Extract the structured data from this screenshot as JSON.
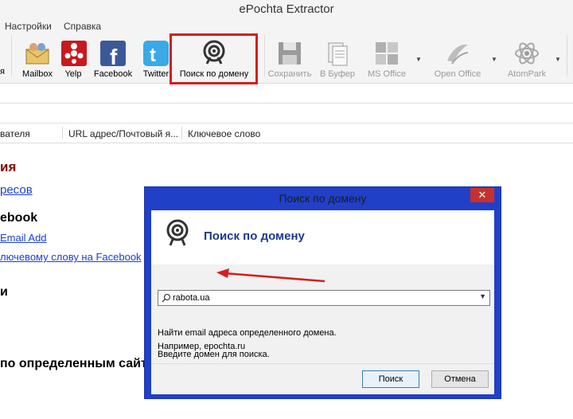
{
  "window": {
    "title": "ePochta Extractor"
  },
  "menu": {
    "items": [
      "Настройки",
      "Справка"
    ]
  },
  "toolbar": {
    "partial_left_label": "я",
    "buttons": [
      {
        "label": "Mailbox",
        "icon": "mailbox-icon"
      },
      {
        "label": "Yelp",
        "icon": "yelp-icon"
      },
      {
        "label": "Facebook",
        "icon": "facebook-icon"
      },
      {
        "label": "Twitter",
        "icon": "twitter-icon"
      },
      {
        "label": "Поиск по домену",
        "icon": "domain-search-icon"
      },
      {
        "label": "Сохранить",
        "icon": "save-icon",
        "disabled": true
      },
      {
        "label": "В Буфер",
        "icon": "clipboard-icon",
        "disabled": true
      },
      {
        "label": "MS Office",
        "icon": "ms-office-icon",
        "disabled": true
      },
      {
        "label": "Open Office",
        "icon": "open-office-icon",
        "disabled": true
      },
      {
        "label": "AtomPark",
        "icon": "atompark-icon",
        "disabled": true
      }
    ]
  },
  "columns": [
    "вателя",
    "URL адрес/Почтовый я...",
    "Ключевое слово"
  ],
  "left_content": {
    "heading1": "ия",
    "link1": "ресов",
    "heading2": "ebook",
    "link2": "Email Add",
    "link3": "лючевому слову на Facebook",
    "heading3": "и",
    "heading4": "по определенным сайт"
  },
  "dialog": {
    "title": "Поиск по домену",
    "close": "✕",
    "heading": "Поиск по домену",
    "domain_value": "rabota.ua",
    "text1": "Найти email адреса определенного домена.",
    "text2": "Введите домен для поиска.",
    "text3": "Например, epochta.ru",
    "search_button": "Поиск",
    "cancel_button": "Отмена"
  },
  "colors": {
    "dialog_frame": "#2040c8",
    "highlight": "#d31f1f",
    "arrow": "#d31f1f"
  }
}
